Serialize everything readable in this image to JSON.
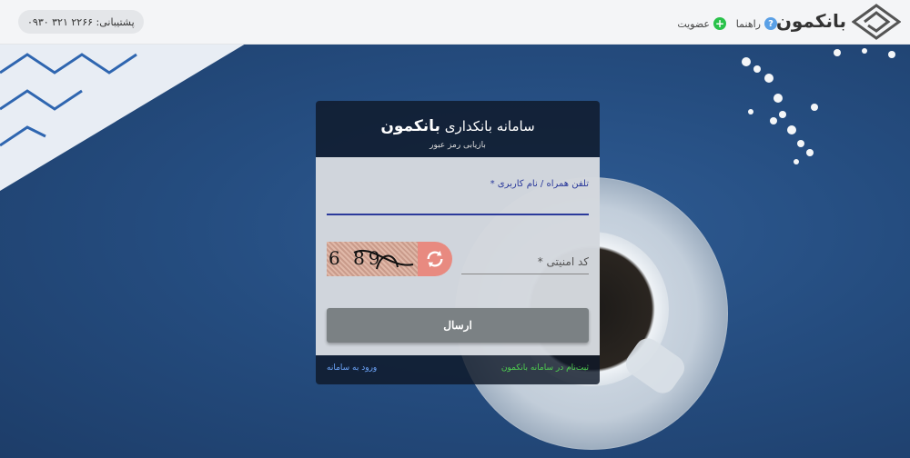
{
  "header": {
    "brand": "بانکمون",
    "help_label": "راهنما",
    "help_icon": "question-icon",
    "member_label": "عضویت",
    "member_icon": "plus-icon",
    "support_text": "پشتیبانی: ۲۲۶۶ ۳۲۱ ۰۹۳۰"
  },
  "card": {
    "title_prefix": "سامانه بانکداری",
    "title_brand": "بانکمون",
    "subtitle": "بازیابی رمز عبور",
    "username_label": "تلفن همراه / نام کاربری *",
    "username_value": "",
    "captcha_text": "6 89",
    "captcha_label": "کد امنیتی *",
    "captcha_value": "",
    "submit_label": "ارسال",
    "register_link": "ثبت‌نام در سامانه بانکمون",
    "login_link": "ورود به سامانه"
  },
  "colors": {
    "header_bg": "#f4f5f7",
    "accent_blue": "#2b3a9b",
    "refresh_bg": "#e88a80",
    "submit_bg": "#7b8184",
    "register_link": "#4fd14f",
    "login_link": "#6fa8ff"
  }
}
